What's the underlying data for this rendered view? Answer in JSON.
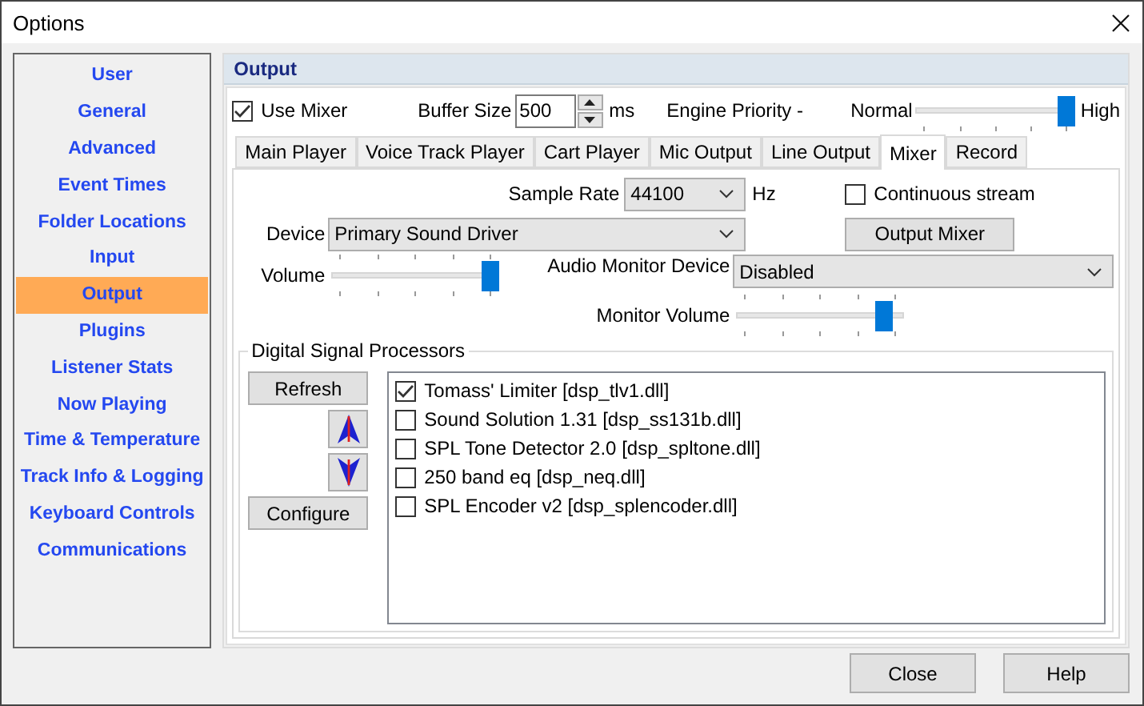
{
  "window": {
    "title": "Options"
  },
  "sidebar": {
    "items": [
      {
        "label": "User",
        "selected": false
      },
      {
        "label": "General",
        "selected": false
      },
      {
        "label": "Advanced",
        "selected": false
      },
      {
        "label": "Event Times",
        "selected": false
      },
      {
        "label": "Folder Locations",
        "selected": false
      },
      {
        "label": "Input",
        "selected": false
      },
      {
        "label": "Output",
        "selected": true
      },
      {
        "label": "Plugins",
        "selected": false
      },
      {
        "label": "Listener Stats",
        "selected": false
      },
      {
        "label": "Now Playing",
        "selected": false
      },
      {
        "label": "Time & Temperature",
        "selected": false
      },
      {
        "label": "Track Info & Logging",
        "selected": false
      },
      {
        "label": "Keyboard Controls",
        "selected": false
      },
      {
        "label": "Communications",
        "selected": false
      }
    ]
  },
  "panel": {
    "title": "Output"
  },
  "use_mixer": {
    "label": "Use Mixer",
    "checked": true
  },
  "buffer_size": {
    "label": "Buffer Size",
    "value": "500",
    "unit": "ms"
  },
  "engine_priority": {
    "label": "Engine Priority -",
    "min_label": "Normal",
    "max_label": "High",
    "level": 1
  },
  "tabs": [
    {
      "label": "Main Player",
      "selected": false
    },
    {
      "label": "Voice Track Player",
      "selected": false
    },
    {
      "label": "Cart Player",
      "selected": false
    },
    {
      "label": "Mic Output",
      "selected": false
    },
    {
      "label": "Line Output",
      "selected": false
    },
    {
      "label": "Mixer",
      "selected": true
    },
    {
      "label": "Record",
      "selected": false
    }
  ],
  "mixer": {
    "sample_rate": {
      "label": "Sample Rate",
      "value": "44100",
      "unit": "Hz"
    },
    "continuous_stream": {
      "label": "Continuous stream",
      "checked": false
    },
    "device": {
      "label": "Device",
      "value": "Primary Sound Driver"
    },
    "output_mixer_button": "Output Mixer",
    "volume": {
      "label": "Volume",
      "level": 1
    },
    "audio_monitor_device": {
      "label": "Audio Monitor Device",
      "value": "Disabled"
    },
    "monitor_volume": {
      "label": "Monitor Volume",
      "level": 0.92
    }
  },
  "dsp": {
    "title": "Digital Signal Processors",
    "refresh": "Refresh",
    "configure": "Configure",
    "items": [
      {
        "label": "Tomass' Limiter [dsp_tlv1.dll]",
        "checked": true
      },
      {
        "label": "Sound Solution 1.31 [dsp_ss131b.dll]",
        "checked": false
      },
      {
        "label": "SPL Tone Detector 2.0 [dsp_spltone.dll]",
        "checked": false
      },
      {
        "label": "250 band eq [dsp_neq.dll]",
        "checked": false
      },
      {
        "label": "SPL Encoder v2 [dsp_splencoder.dll]",
        "checked": false
      }
    ]
  },
  "footer_buttons": [
    "Close",
    "Help"
  ]
}
